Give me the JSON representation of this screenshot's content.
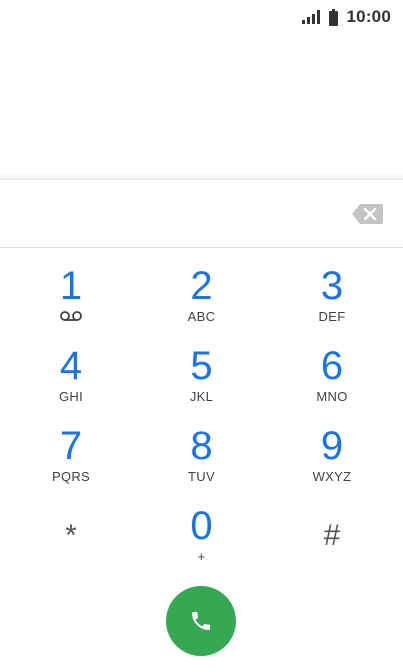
{
  "status_bar": {
    "time": "10:00",
    "signal_icon": "cellular-signal-icon",
    "battery_icon": "battery-full-icon"
  },
  "dialer": {
    "digits_value": "",
    "backspace_icon": "backspace-icon",
    "keys": [
      {
        "digit": "1",
        "letters": "",
        "icon": "voicemail-icon"
      },
      {
        "digit": "2",
        "letters": "ABC"
      },
      {
        "digit": "3",
        "letters": "DEF"
      },
      {
        "digit": "4",
        "letters": "GHI"
      },
      {
        "digit": "5",
        "letters": "JKL"
      },
      {
        "digit": "6",
        "letters": "MNO"
      },
      {
        "digit": "7",
        "letters": "PQRS"
      },
      {
        "digit": "8",
        "letters": "TUV"
      },
      {
        "digit": "9",
        "letters": "WXYZ"
      },
      {
        "digit": "*",
        "letters": ""
      },
      {
        "digit": "0",
        "letters": "+"
      },
      {
        "digit": "#",
        "letters": ""
      }
    ],
    "call_icon": "phone-icon"
  },
  "colors": {
    "accent_blue": "#1a73e8",
    "call_green": "#34a853"
  }
}
